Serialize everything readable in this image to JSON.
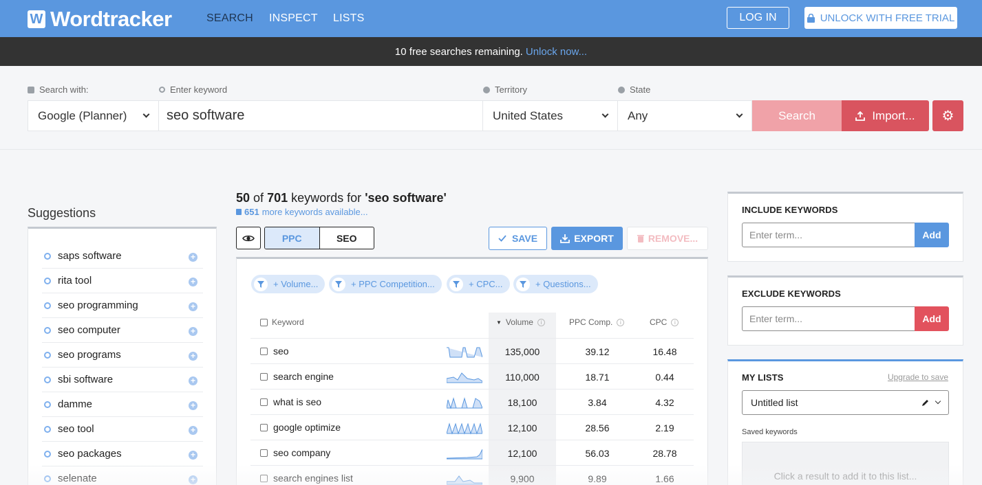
{
  "brand": {
    "logo_letter": "W",
    "name": "Wordtracker",
    "accent": "#5a97df",
    "danger": "#d9545f"
  },
  "nav": [
    {
      "label": "SEARCH",
      "active": true
    },
    {
      "label": "INSPECT",
      "active": false
    },
    {
      "label": "LISTS",
      "active": false
    }
  ],
  "header": {
    "login": "LOG IN",
    "unlock": "UNLOCK WITH FREE TRIAL"
  },
  "notice": {
    "text": "10 free searches remaining.",
    "link": "Unlock now..."
  },
  "search": {
    "search_with_label": "Search with:",
    "search_with_value": "Google (Planner)",
    "keyword_label": "Enter keyword",
    "keyword_value": "seo software",
    "territory_label": "Territory",
    "territory_value": "United States",
    "state_label": "State",
    "state_value": "Any",
    "search_button": "Search",
    "import_button": "Import..."
  },
  "suggestions": {
    "title": "Suggestions",
    "items": [
      "saps software",
      "rita tool",
      "seo programming",
      "seo computer",
      "seo programs",
      "sbi software",
      "damme",
      "seo tool",
      "seo packages",
      "selenate"
    ]
  },
  "results": {
    "count": "50",
    "of": "of",
    "total": "701",
    "mid": "keywords for",
    "query": "'seo software'",
    "more_count": "651",
    "more_text": "more keywords available...",
    "toggle": [
      "PPC",
      "SEO"
    ],
    "save": "SAVE",
    "export": "EXPORT",
    "remove": "REMOVE...",
    "filters": [
      "+ Volume...",
      "+ PPC Competition...",
      "+ CPC...",
      "+ Questions..."
    ],
    "columns": {
      "keyword": "Keyword",
      "volume": "Volume",
      "ppc": "PPC Comp.",
      "cpc": "CPC"
    },
    "rows": [
      {
        "keyword": "seo",
        "volume": "135,000",
        "ppc": "39.12",
        "cpc": "16.48"
      },
      {
        "keyword": "search engine",
        "volume": "110,000",
        "ppc": "18.71",
        "cpc": "0.44"
      },
      {
        "keyword": "what is seo",
        "volume": "18,100",
        "ppc": "3.84",
        "cpc": "4.32"
      },
      {
        "keyword": "google optimize",
        "volume": "12,100",
        "ppc": "28.56",
        "cpc": "2.19"
      },
      {
        "keyword": "seo company",
        "volume": "12,100",
        "ppc": "56.03",
        "cpc": "28.78"
      },
      {
        "keyword": "search engines list",
        "volume": "9,900",
        "ppc": "9.89",
        "cpc": "1.66"
      }
    ]
  },
  "include": {
    "title": "INCLUDE KEYWORDS",
    "placeholder": "Enter term...",
    "add": "Add"
  },
  "exclude": {
    "title": "EXCLUDE KEYWORDS",
    "placeholder": "Enter term...",
    "add": "Add"
  },
  "mylists": {
    "title": "MY LISTS",
    "upgrade": "Upgrade to save",
    "selected": "Untitled list",
    "saved_label": "Saved keywords",
    "empty": "Click a result to add it to this list..."
  }
}
